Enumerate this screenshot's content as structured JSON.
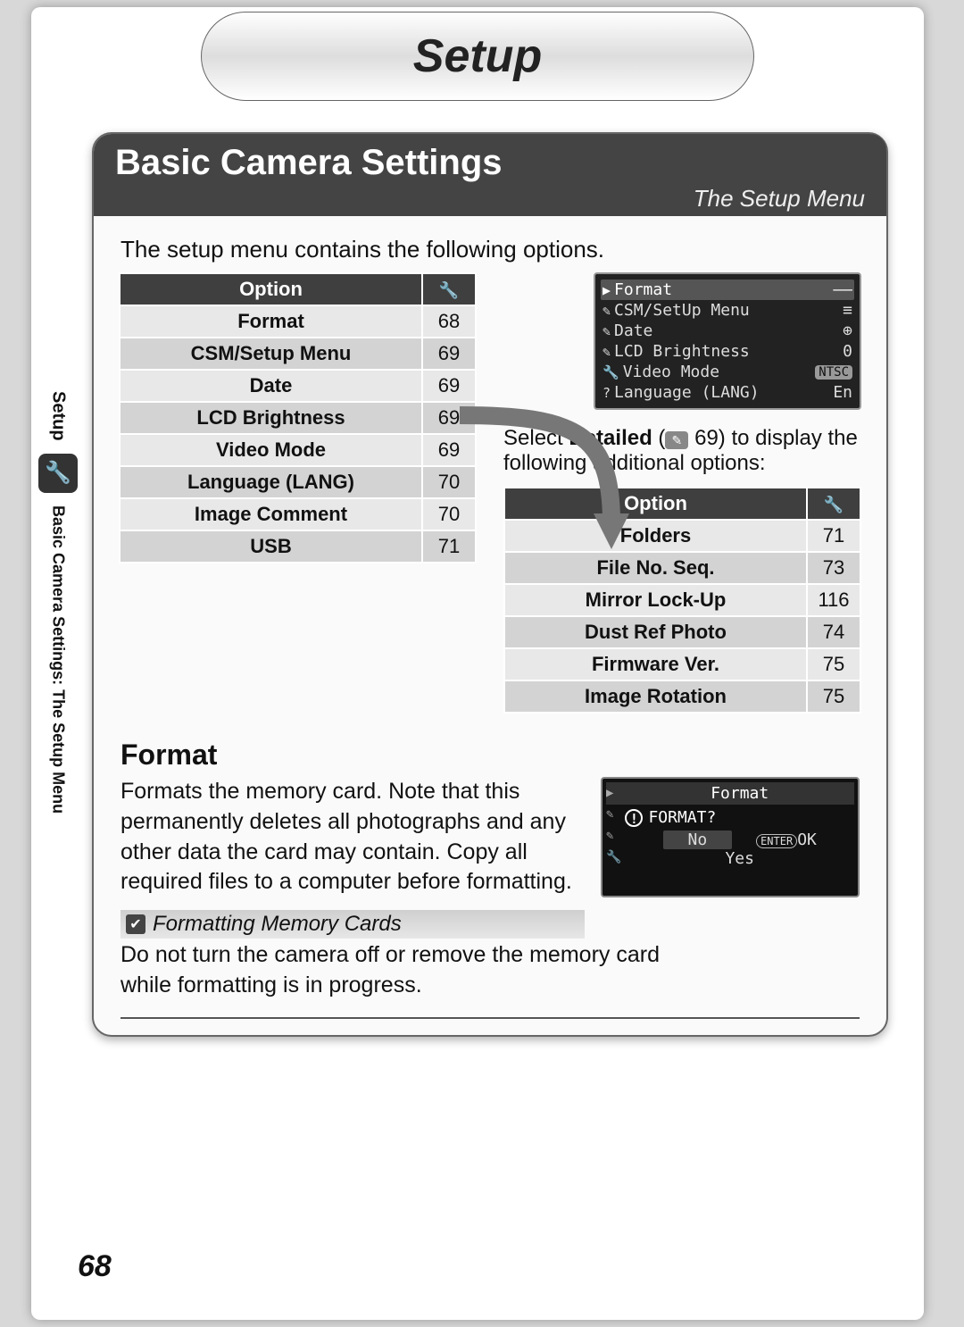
{
  "chapter": "Setup",
  "panel": {
    "title": "Basic Camera Settings",
    "subtitle": "The Setup Menu"
  },
  "intro": "The setup menu contains the following options.",
  "table1": {
    "header_option": "Option",
    "rows": [
      {
        "name": "Format",
        "page": "68"
      },
      {
        "name": "CSM/Setup Menu",
        "page": "69"
      },
      {
        "name": "Date",
        "page": "69"
      },
      {
        "name": "LCD Brightness",
        "page": "69"
      },
      {
        "name": "Video Mode",
        "page": "69"
      },
      {
        "name": "Language (LANG)",
        "page": "70"
      },
      {
        "name": "Image Comment",
        "page": "70"
      },
      {
        "name": "USB",
        "page": "71"
      }
    ]
  },
  "lcd_menu": {
    "rows": [
      {
        "icon": "▶",
        "label": "Format",
        "value": "––"
      },
      {
        "icon": "✎",
        "label": "CSM/SetUp Menu",
        "value": "≡"
      },
      {
        "icon": "✎",
        "label": "Date",
        "value": "⊕"
      },
      {
        "icon": "✎",
        "label": "LCD Brightness",
        "value": "0"
      },
      {
        "icon": "🔧",
        "label": "Video Mode",
        "value": "NTSC"
      },
      {
        "icon": "?",
        "label": "Language (LANG)",
        "value": "En"
      }
    ]
  },
  "detail": {
    "pre": "Select ",
    "bold": "Detailed",
    "mid": " (",
    "page": "69",
    "post": ") to display the following additional options:"
  },
  "table2": {
    "header_option": "Option",
    "rows": [
      {
        "name": "Folders",
        "page": "71"
      },
      {
        "name": "File No. Seq.",
        "page": "73"
      },
      {
        "name": "Mirror Lock-Up",
        "page": "116"
      },
      {
        "name": "Dust Ref Photo",
        "page": "74"
      },
      {
        "name": "Firmware Ver.",
        "page": "75"
      },
      {
        "name": "Image Rotation",
        "page": "75"
      }
    ]
  },
  "format": {
    "heading": "Format",
    "text": "Formats the memory card.  Note that this permanently deletes all photographs and any other data the card may contain.  Copy all required files to a computer before formatting.",
    "lcd": {
      "title": "Format",
      "prompt": "FORMAT?",
      "no": "No",
      "yes": "Yes",
      "enter": "ENTER",
      "ok": "OK"
    }
  },
  "tip": {
    "title": "Formatting Memory Cards",
    "text": "Do not turn the camera off or remove the memory card while formatting is in progress."
  },
  "sidetab": {
    "top": "Setup",
    "bottom": "Basic Camera Settings: The Setup Menu"
  },
  "page_number": "68"
}
